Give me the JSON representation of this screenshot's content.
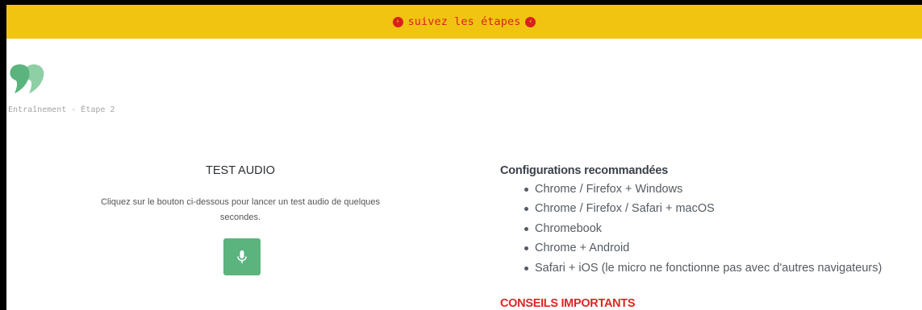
{
  "banner": {
    "text": "suivez les étapes",
    "left_icon": "chevron-circle-right-icon",
    "right_icon": "chevron-circle-left-icon",
    "background": "#f2c412",
    "text_color": "#d92020"
  },
  "logo": {
    "icon": "quote-logo-icon",
    "color": "#5bb37e"
  },
  "step_label": "Entraînement - Étape 2",
  "audio_test": {
    "title": "TEST AUDIO",
    "description": "Cliquez sur le bouton ci-dessous pour lancer un test audio de quelques secondes.",
    "button_icon": "microphone-icon",
    "button_color": "#5bb37e"
  },
  "config": {
    "title": "Configurations recommandées",
    "items": [
      "Chrome / Firefox + Windows",
      "Chrome / Firefox / Safari + macOS",
      "Chromebook",
      "Chrome + Android",
      "Safari + iOS (le micro ne fonctionne pas avec d'autres navigateurs)"
    ]
  },
  "conseils": {
    "title": "CONSEILS IMPORTANTS",
    "color": "#e02424"
  }
}
